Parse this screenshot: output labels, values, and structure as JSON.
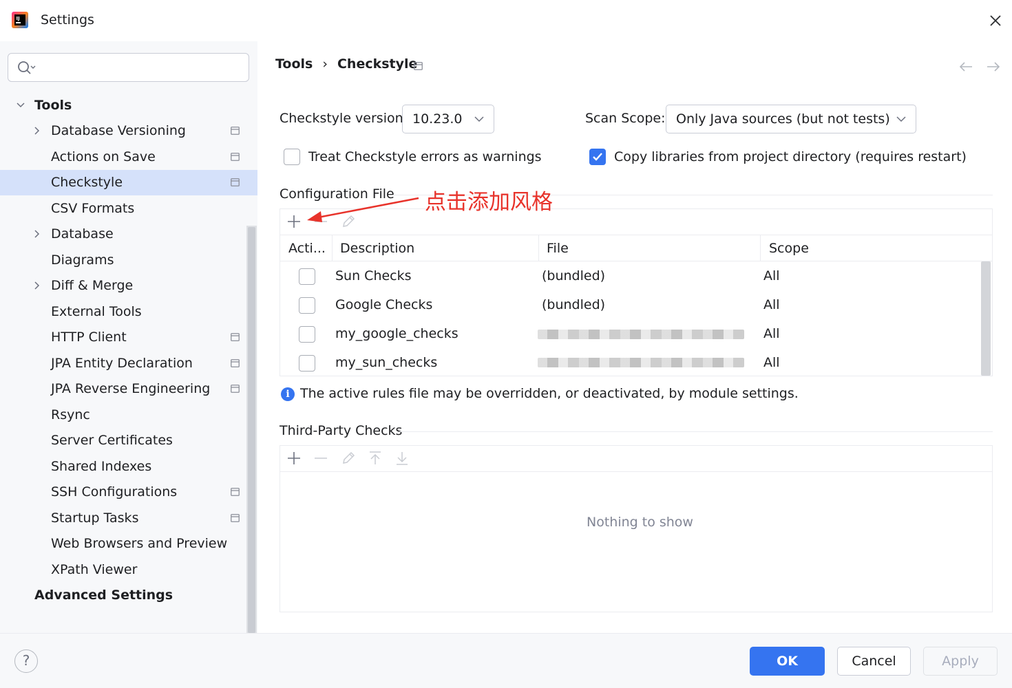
{
  "window": {
    "title": "Settings"
  },
  "search": {
    "placeholder": "",
    "value": ""
  },
  "sidebar": {
    "group_label": "Tools",
    "items": [
      {
        "label": "Database Versioning"
      },
      {
        "label": "Actions on Save"
      },
      {
        "label": "Checkstyle"
      },
      {
        "label": "CSV Formats"
      },
      {
        "label": "Database"
      },
      {
        "label": "Diagrams"
      },
      {
        "label": "Diff & Merge"
      },
      {
        "label": "External Tools"
      },
      {
        "label": "HTTP Client"
      },
      {
        "label": "JPA Entity Declaration"
      },
      {
        "label": "JPA Reverse Engineering"
      },
      {
        "label": "Rsync"
      },
      {
        "label": "Server Certificates"
      },
      {
        "label": "Shared Indexes"
      },
      {
        "label": "SSH Configurations"
      },
      {
        "label": "Startup Tasks"
      },
      {
        "label": "Web Browsers and Preview"
      },
      {
        "label": "XPath Viewer"
      }
    ],
    "advanced_label": "Advanced Settings"
  },
  "breadcrumb": {
    "parent": "Tools",
    "separator": "›",
    "current": "Checkstyle"
  },
  "settings": {
    "version_label": "Checkstyle version:",
    "version_value": "10.23.0",
    "scope_label": "Scan Scope:",
    "scope_value": "Only Java sources (but not tests)",
    "treat_warnings_label": "Treat Checkstyle errors as warnings",
    "treat_warnings_checked": false,
    "copy_libs_label": "Copy libraries from project directory (requires restart)",
    "copy_libs_checked": true
  },
  "config_file": {
    "section_title": "Configuration File",
    "columns": [
      "Acti...",
      "Description",
      "File",
      "Scope"
    ],
    "rows": [
      {
        "active": false,
        "description": "Sun Checks",
        "file": "(bundled)",
        "scope": "All"
      },
      {
        "active": false,
        "description": "Google Checks",
        "file": "(bundled)",
        "scope": "All"
      },
      {
        "active": false,
        "description": "my_google_checks",
        "file": "",
        "scope": "All"
      },
      {
        "active": false,
        "description": "my_sun_checks",
        "file": "",
        "scope": "All"
      }
    ],
    "info_text": "The active rules file may be overridden, or deactivated, by module settings."
  },
  "third_party": {
    "section_title": "Third-Party Checks",
    "empty_text": "Nothing to show"
  },
  "annotation": {
    "text": "点击添加风格",
    "color": "#e8332b"
  },
  "footer": {
    "help": "?",
    "ok": "OK",
    "cancel": "Cancel",
    "apply": "Apply"
  },
  "colors": {
    "accent": "#3574f0",
    "selection": "#d5e1fa",
    "sidebar_bg": "#f7f8fa"
  }
}
